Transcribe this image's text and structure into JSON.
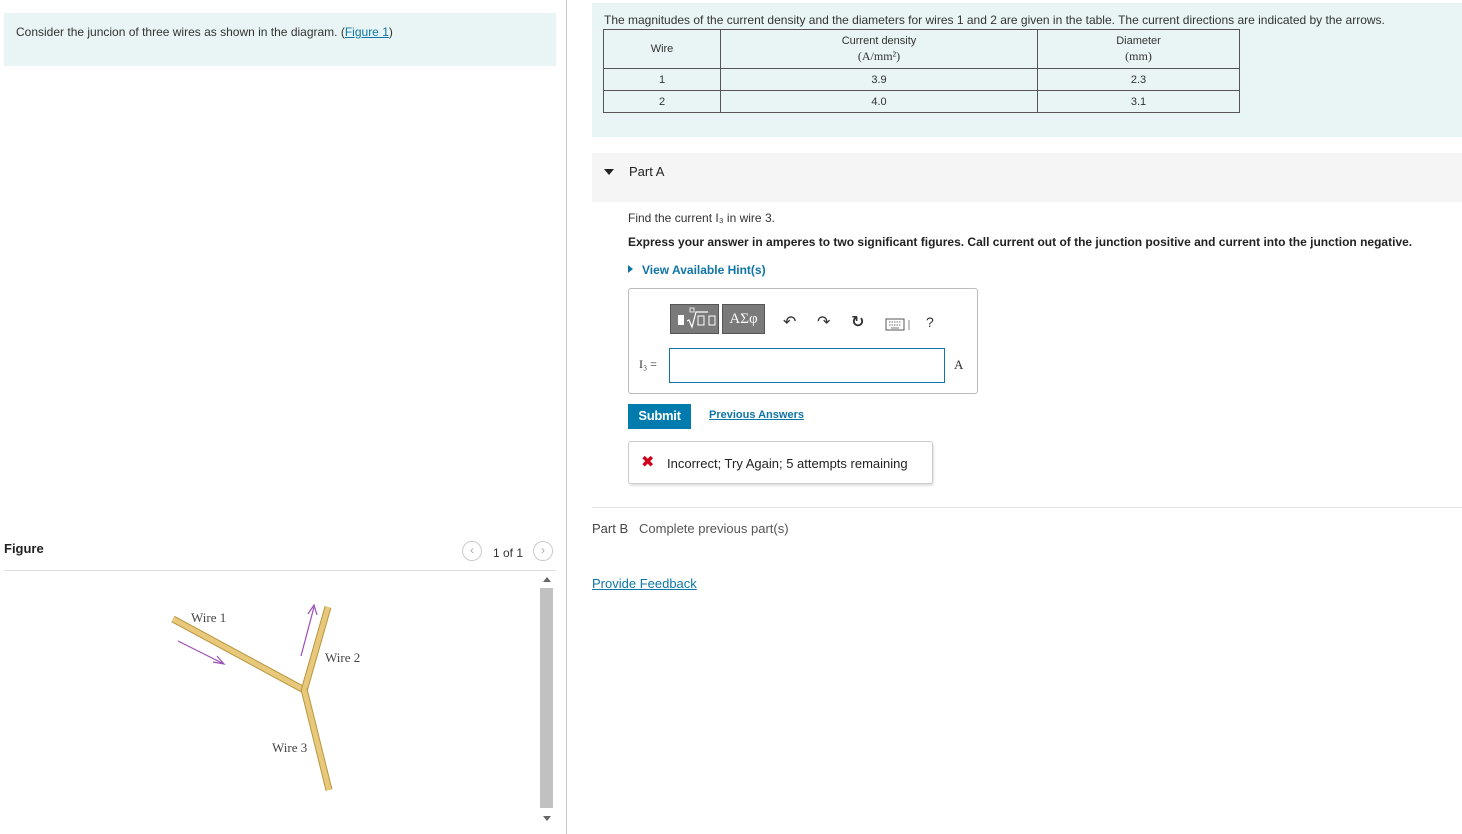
{
  "intro": {
    "text": "Consider the juncion of three wires as shown in the diagram. ",
    "link_text": "Figure 1"
  },
  "figure": {
    "heading": "Figure",
    "pager": "1 of 1",
    "wire_labels": [
      "Wire 1",
      "Wire 2",
      "Wire 3"
    ]
  },
  "problem": {
    "text": "The magnitudes of the current density and the diameters for wires 1 and 2 are given in the table. The current directions are indicated by the arrows.",
    "table": {
      "headers": {
        "wire": "Wire",
        "density": "Current density",
        "density_unit": "(A/mm²)",
        "diameter": "Diameter",
        "diameter_unit": "(mm)"
      },
      "rows": [
        {
          "wire": "1",
          "density": "3.9",
          "diameter": "2.3"
        },
        {
          "wire": "2",
          "density": "4.0",
          "diameter": "3.1"
        }
      ]
    }
  },
  "partA": {
    "title": "Part A",
    "question": "Find the current I₃ in wire 3.",
    "instruction": "Express your answer in amperes to two significant figures. Call current out of the junction positive and current into the junction negative.",
    "hints": "View Available Hint(s)",
    "toolbar": {
      "symbols": "ΑΣφ",
      "help": "?"
    },
    "equation_label": "I₃ =",
    "answer_value": "",
    "unit": "A",
    "submit": "Submit",
    "previous_answers": "Previous Answers",
    "feedback": "Incorrect; Try Again; 5 attempts remaining"
  },
  "partB": {
    "title": "Part B",
    "status": "Complete previous part(s)"
  },
  "footer": {
    "feedback_link": "Provide Feedback"
  },
  "colors": {
    "accent": "#007bad",
    "link": "#0f75a8",
    "panel_bg": "#e8f5f4",
    "error": "#d0021b",
    "wire": "#e8c87a"
  }
}
